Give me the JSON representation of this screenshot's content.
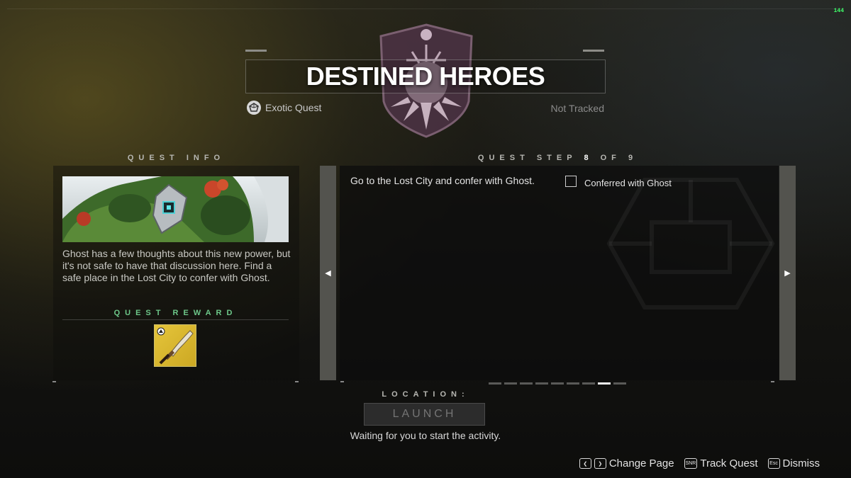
{
  "header": {
    "title": "DESTINED HEROES",
    "quest_type": "Exotic Quest",
    "tracked_status": "Not Tracked",
    "fps": "144"
  },
  "quest_info": {
    "label": "QUEST INFO",
    "description": "Ghost has a few thoughts about this new power, but it's not safe to have that discussion here. Find a safe place in the Lost City to confer with Ghost.",
    "reward_label": "QUEST REWARD"
  },
  "quest_step": {
    "label_prefix": "QUEST STEP",
    "current": "8",
    "of": "OF",
    "total": "9",
    "text": "Go to the Lost City and confer with Ghost.",
    "objective": "Conferred with Ghost",
    "page_count": 9,
    "active_page": 8
  },
  "location": {
    "label": "LOCATION:",
    "launch": "LAUNCH",
    "status": "Waiting for you to start the activity."
  },
  "footer": {
    "change_page": "Change Page",
    "track_key": "SNR",
    "track_quest": "Track Quest",
    "dismiss_key": "Esc",
    "dismiss": "Dismiss"
  },
  "colors": {
    "reward_label": "#6dc789",
    "exotic_gold": "#cca823",
    "fps_green": "#3fff6a"
  }
}
